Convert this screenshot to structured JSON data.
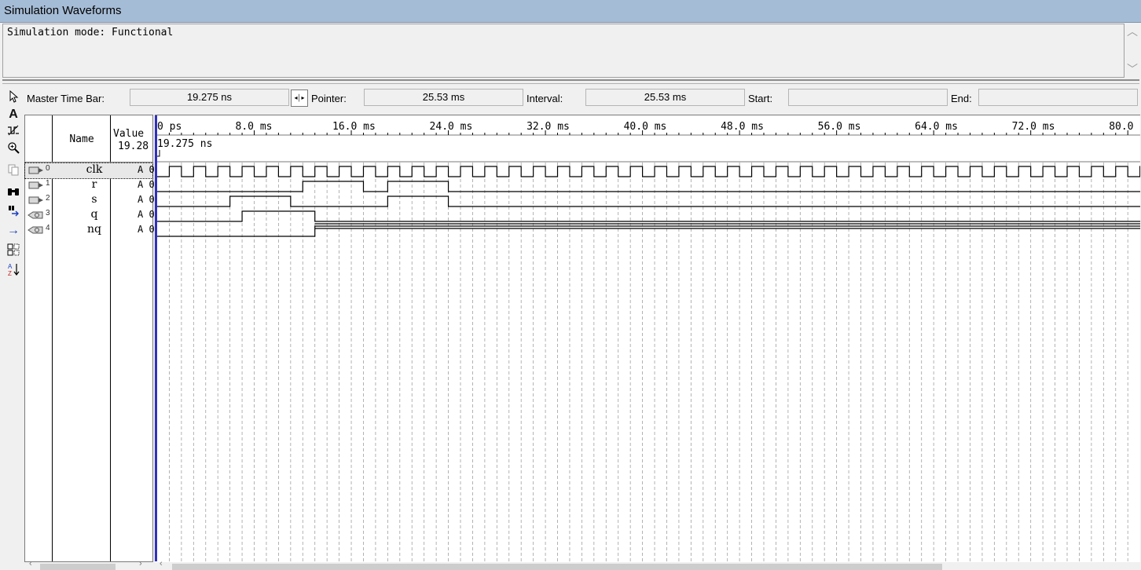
{
  "window": {
    "title": "Simulation Waveforms"
  },
  "mode_text": "Simulation mode: Functional",
  "timebar": {
    "master_label": "Master Time Bar:",
    "master_value": "19.275 ns",
    "pointer_label": "Pointer:",
    "pointer_value": "25.53 ms",
    "interval_label": "Interval:",
    "interval_value": "25.53 ms",
    "start_label": "Start:",
    "start_value": "",
    "end_label": "End:",
    "end_value": ""
  },
  "toolbar_icons": [
    "pointer-icon",
    "text-tool-icon",
    "waveform-editing-icon",
    "zoom-icon",
    "copy-icon",
    "find-icon",
    "replace-icon",
    "arrow-right-icon",
    "group-icon",
    "sort-icon"
  ],
  "columns": {
    "name": "Name",
    "value": "Value",
    "value_sub": "19.28"
  },
  "signals": [
    {
      "index": "0",
      "name": "clk",
      "value": "A 0",
      "type": "input"
    },
    {
      "index": "1",
      "name": "r",
      "value": "A 0",
      "type": "input"
    },
    {
      "index": "2",
      "name": "s",
      "value": "A 0",
      "type": "input"
    },
    {
      "index": "3",
      "name": "q",
      "value": "A 0",
      "type": "output"
    },
    {
      "index": "4",
      "name": "nq",
      "value": "A 0",
      "type": "output"
    }
  ],
  "timeline": {
    "ticks": [
      "0 ps",
      "8.0 ms",
      "16.0 ms",
      "24.0 ms",
      "32.0 ms",
      "40.0 ms",
      "48.0 ms",
      "56.0 ms",
      "64.0 ms",
      "72.0 ms",
      "80.0 ms"
    ],
    "cursor_label": "19.275 ns",
    "time_max_ms": 81,
    "clk_period_ms": 2,
    "r_high": [
      [
        12,
        17
      ],
      [
        19,
        24
      ]
    ],
    "s_high": [
      [
        6,
        11
      ],
      [
        19,
        24
      ]
    ],
    "q_high": [
      [
        7,
        13
      ]
    ],
    "nq_unknown_from_ms": 13
  },
  "colors": {
    "cursor": "#3030c0",
    "grid": "#a0a0a0",
    "titlebar": "#a5bcd6"
  }
}
